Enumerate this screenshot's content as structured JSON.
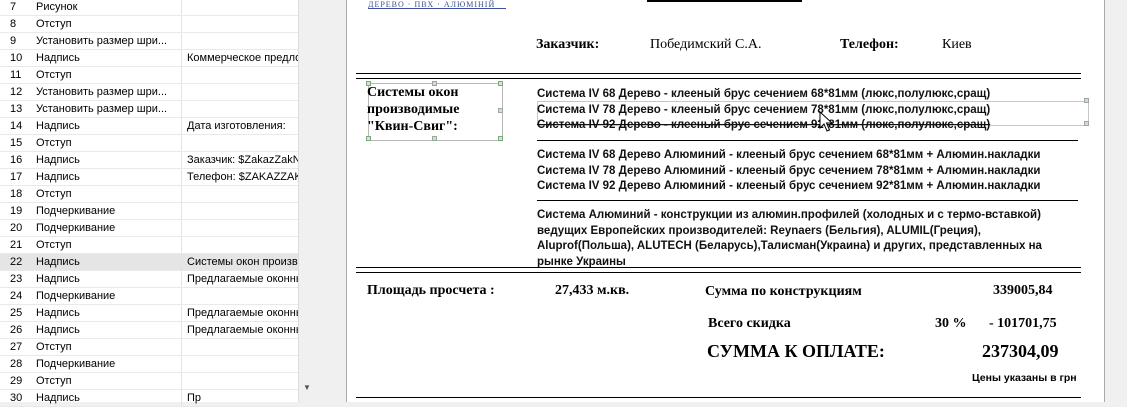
{
  "list": {
    "rows": [
      {
        "num": "7",
        "type": "Рисунок",
        "text": ""
      },
      {
        "num": "8",
        "type": "Отступ",
        "text": ""
      },
      {
        "num": "9",
        "type": "Установить размер шри...",
        "text": ""
      },
      {
        "num": "10",
        "type": "Надпись",
        "text": "Коммерческое предло"
      },
      {
        "num": "11",
        "type": "Отступ",
        "text": ""
      },
      {
        "num": "12",
        "type": "Установить размер шри...",
        "text": ""
      },
      {
        "num": "13",
        "type": "Установить размер шри...",
        "text": ""
      },
      {
        "num": "14",
        "type": "Надпись",
        "text": "Дата изготовления:"
      },
      {
        "num": "15",
        "type": "Отступ",
        "text": ""
      },
      {
        "num": "16",
        "type": "Надпись",
        "text": "Заказчик: $ZakazZakN"
      },
      {
        "num": "17",
        "type": "Надпись",
        "text": "Телефон: $ZAKAZZAKT"
      },
      {
        "num": "18",
        "type": "Отступ",
        "text": ""
      },
      {
        "num": "19",
        "type": "Подчеркивание",
        "text": ""
      },
      {
        "num": "20",
        "type": "Подчеркивание",
        "text": ""
      },
      {
        "num": "21",
        "type": "Отступ",
        "text": ""
      },
      {
        "num": "22",
        "type": "Надпись",
        "text": "Системы окон произво"
      },
      {
        "num": "23",
        "type": "Надпись",
        "text": "Предлагаемые оконны"
      },
      {
        "num": "24",
        "type": "Подчеркивание",
        "text": ""
      },
      {
        "num": "25",
        "type": "Надпись",
        "text": "Предлагаемые оконны"
      },
      {
        "num": "26",
        "type": "Надпись",
        "text": "Предлагаемые оконны"
      },
      {
        "num": "27",
        "type": "Отступ",
        "text": ""
      },
      {
        "num": "28",
        "type": "Подчеркивание",
        "text": ""
      },
      {
        "num": "29",
        "type": "Отступ",
        "text": ""
      },
      {
        "num": "30",
        "type": "Надпись",
        "text": "Пр"
      }
    ],
    "selected_index": 15
  },
  "doc": {
    "logo_text": "ДЕРЕВО · ПВХ · АЛЮМІНІЙ",
    "customer_label": "Заказчик:",
    "customer_value": "Победимский С.А.",
    "phone_label": "Телефон:",
    "phone_value": "Киев",
    "systems_heading_1": "Системы окон",
    "systems_heading_2": "производимые",
    "systems_heading_3": "\"Квин-Свиг\":",
    "wood_lines": [
      "Система IV 68 Дерево - клееный брус сечением 68*81мм (люкс,полулюкс,сращ)",
      "Система IV 78 Дерево - клееный брус сечением 78*81мм (люкс,полулюкс,сращ)",
      "Система IV 92 Дерево - клееный брус сечением 92*81мм (люкс,полулюкс,сращ)"
    ],
    "woodalu_lines": [
      "Система IV 68 Дерево Алюминий - клееный брус сечением 68*81мм + Алюмин.накладки",
      "Система IV 78 Дерево Алюминий - клееный брус сечением 78*81мм + Алюмин.накладки",
      "Система IV 92 Дерево Алюминий - клееный брус сечением 92*81мм + Алюмин.накладки"
    ],
    "alu_lines": [
      "Система  Алюминий - конструкции из алюмин.профилей (холодных и с термо-вставкой)",
      "ведущих Европейских производителей: Reynaers (Бельгия), ALUMIL(Греция),",
      "Aluprof(Польша), ALUTECH (Беларусь),Талисман(Украина) и других, представленных на",
      "рынке Украины"
    ],
    "area_label": "Площадь просчета :",
    "area_value": "27,433 м.кв.",
    "sum_label": "Сумма по конструкциям",
    "sum_value": "339005,84",
    "discount_label": "Всего скидка",
    "discount_percent": "30 %",
    "discount_value": "- 101701,75",
    "total_label": "СУММА К ОПЛАТЕ:",
    "total_value": "237304,09",
    "currency_note": "Цены указаны в грн"
  }
}
